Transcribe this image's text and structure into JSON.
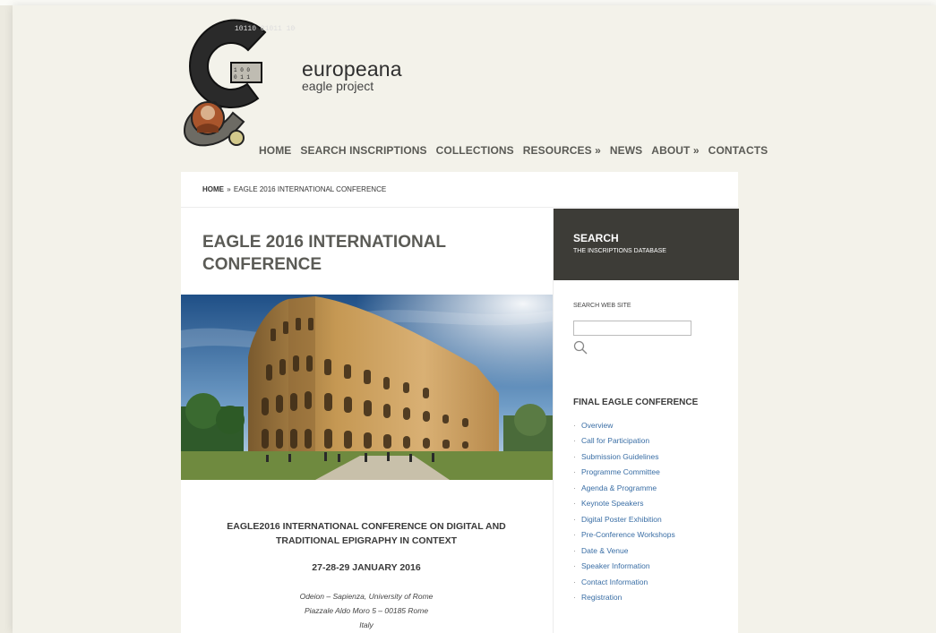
{
  "brand": {
    "title": "europeana",
    "subtitle": "eagle project",
    "logo_digits": "10110 01011 10001"
  },
  "nav": {
    "items": [
      {
        "label": "HOME"
      },
      {
        "label": "SEARCH INSCRIPTIONS"
      },
      {
        "label": "COLLECTIONS"
      },
      {
        "label": "RESOURCES »"
      },
      {
        "label": "NEWS"
      },
      {
        "label": "ABOUT »"
      },
      {
        "label": "CONTACTS"
      }
    ]
  },
  "breadcrumb": {
    "home": "HOME",
    "sep": "»",
    "current": "EAGLE 2016 INTERNATIONAL CONFERENCE"
  },
  "page": {
    "title": "EAGLE 2016 INTERNATIONAL CONFERENCE",
    "conference_title": "EAGLE2016 INTERNATIONAL CONFERENCE ON DIGITAL AND TRADITIONAL EPIGRAPHY IN CONTEXT",
    "dates": "27-28-29 JANUARY 2016",
    "venue_line1": "Odeion – Sapienza, University of Rome",
    "venue_line2": "Piazzale Aldo Moro 5 – 00185 Rome",
    "venue_line3": "Italy"
  },
  "sidebar": {
    "search_title": "SEARCH",
    "search_subtitle": "THE INSCRIPTIONS DATABASE",
    "search_website_label": "SEARCH WEB SITE",
    "search_website_value": "",
    "conference_heading": "FINAL EAGLE CONFERENCE",
    "conference_links": [
      {
        "label": "Overview"
      },
      {
        "label": "Call for Participation"
      },
      {
        "label": "Submission Guidelines"
      },
      {
        "label": "Programme Committee"
      },
      {
        "label": "Agenda & Programme"
      },
      {
        "label": "Keynote Speakers"
      },
      {
        "label": "Digital Poster Exhibition"
      },
      {
        "label": "Pre-Conference Workshops"
      },
      {
        "label": "Date & Venue"
      },
      {
        "label": "Speaker Information"
      },
      {
        "label": "Contact Information"
      },
      {
        "label": "Registration"
      }
    ]
  },
  "colors": {
    "page_bg": "#eceae0",
    "nav_text": "#5a5a55",
    "sidebar_dark": "#3d3c37",
    "link": "#3a6ea5"
  }
}
